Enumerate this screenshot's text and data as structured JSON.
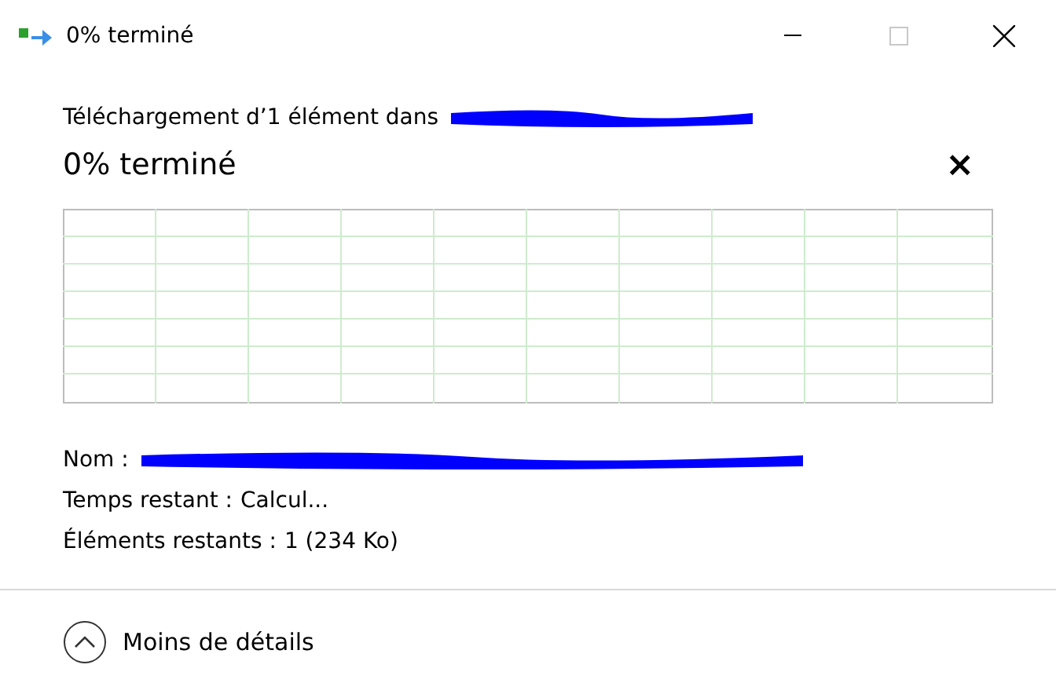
{
  "window": {
    "title": "0% terminé",
    "controls": [
      {
        "kind": "minimize",
        "disabled": false
      },
      {
        "kind": "maximize",
        "disabled": true
      },
      {
        "kind": "close",
        "disabled": false
      }
    ]
  },
  "header": {
    "text": "Téléchargement d’1 élément dans",
    "destination_redacted": true
  },
  "progress": {
    "title": "0% terminé",
    "close": "×"
  },
  "details": [
    {
      "label": "Nom :",
      "value_redacted": true
    },
    {
      "label": "Temps restant :",
      "value": "Calcul..."
    },
    {
      "label": "Éléments restants :",
      "value": "1 (234 Ko)"
    }
  ],
  "footer": {
    "label": "Moins de détails",
    "expanded": true
  }
}
